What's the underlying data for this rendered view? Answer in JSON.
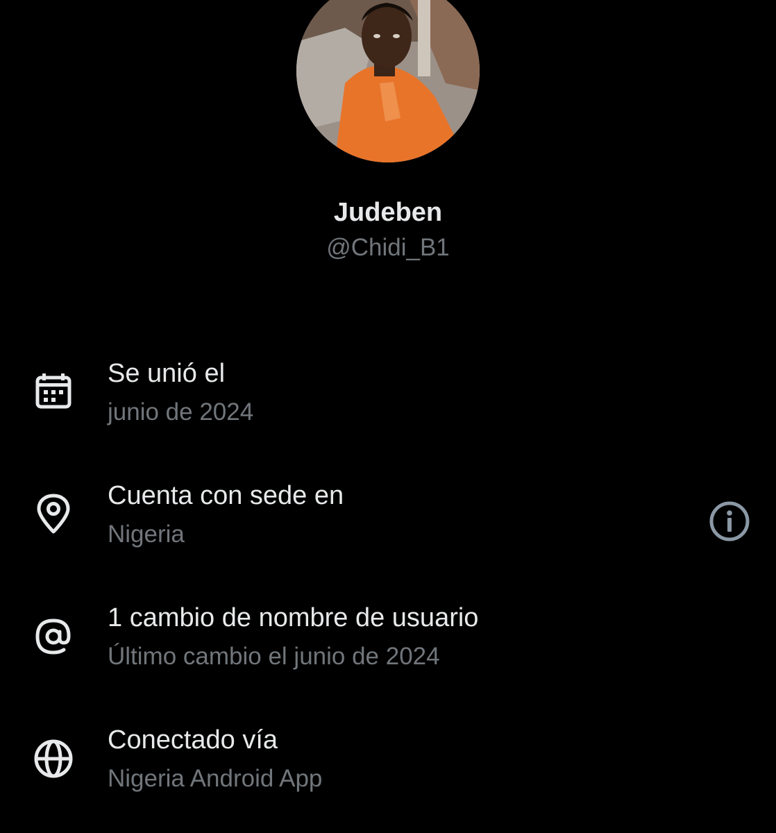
{
  "profile": {
    "display_name": "Judeben",
    "handle": "@Chidi_B1",
    "avatar_icon": "profile-photo"
  },
  "about": {
    "rows": [
      {
        "icon": "calendar-icon",
        "title": "Se unió el",
        "subtitle": "junio de 2024"
      },
      {
        "icon": "location-pin-icon",
        "title": "Cuenta con sede en",
        "subtitle": "Nigeria",
        "trailing_icon": "info-icon"
      },
      {
        "icon": "at-sign-icon",
        "title": "1 cambio de nombre de usuario",
        "subtitle": "Último cambio el junio de 2024"
      },
      {
        "icon": "globe-icon",
        "title": "Conectado vía",
        "subtitle": "Nigeria Android App"
      }
    ]
  },
  "colors": {
    "background": "#000000",
    "primary_text": "#e7e9ea",
    "secondary_text": "#71767b"
  }
}
